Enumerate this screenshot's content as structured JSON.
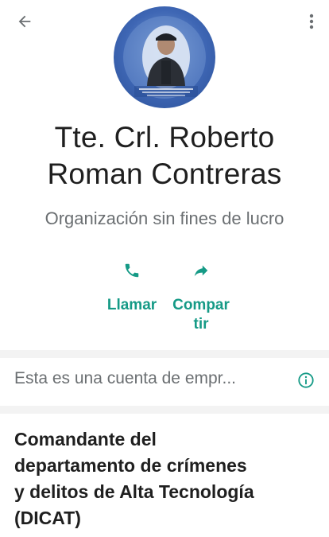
{
  "profile": {
    "name_line1": "Tte. Crl. Roberto",
    "name_line2": "Roman Contreras",
    "category": "Organización sin fines de lucro"
  },
  "actions": {
    "call_label": "Llamar",
    "share_label_line1": "Compar",
    "share_label_line2": "tir"
  },
  "business_notice": {
    "text": "Esta es una cuenta de empr..."
  },
  "description": {
    "line1": "Comandante del",
    "line2": "departamento de crímenes",
    "line3": "y delitos de Alta Tecnología",
    "line4": "(DICAT)"
  },
  "icons": {
    "back": "arrow-left-icon",
    "menu": "more-vertical-icon",
    "call": "phone-icon",
    "share": "share-arrow-icon",
    "info": "info-icon"
  },
  "colors": {
    "accent": "#159a86",
    "text_primary": "#1f1f1f",
    "text_secondary": "#6b6f72",
    "divider": "#f3f3f3"
  }
}
